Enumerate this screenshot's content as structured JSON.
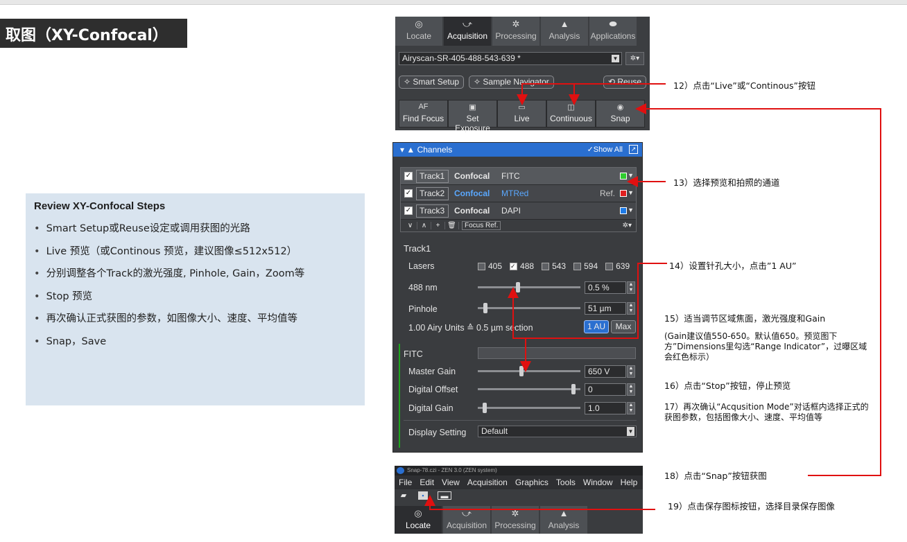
{
  "page_title": "取图（XY-Confocal）",
  "review": {
    "heading": "Review XY-Confocal Steps",
    "items": [
      "Smart Setup或Reuse设定或调用获图的光路",
      "Live 预览（或Continous 预览，建议图像≤512x512）",
      "分别调整各个Track的激光强度, Pinhole, Gain，Zoom等",
      "Stop 预览",
      "再次确认正式获图的参数，如图像大小、速度、平均值等",
      "Snap，Save"
    ]
  },
  "zen_top": {
    "tabs": [
      {
        "label": "Locate",
        "icon": "locate-icon"
      },
      {
        "label": "Acquisition",
        "icon": "acquisition-icon"
      },
      {
        "label": "Processing",
        "icon": "processing-icon"
      },
      {
        "label": "Analysis",
        "icon": "analysis-icon"
      },
      {
        "label": "Applications",
        "icon": "applications-icon"
      }
    ],
    "active_tab": "Acquisition",
    "config_value": "Airyscan-SR-405-488-543-639 *",
    "smart_setup": "Smart Setup",
    "sample_navigator": "Sample Navigator",
    "reuse": "Reuse",
    "buttons": [
      {
        "label": "Find Focus",
        "icon_text": "AF"
      },
      {
        "label": "Set Exposure",
        "icon_text": "▣"
      },
      {
        "label": "Live",
        "icon_text": "▭"
      },
      {
        "label": "Continuous",
        "icon_text": "◫"
      },
      {
        "label": "Snap",
        "icon_text": "◉"
      }
    ]
  },
  "channels": {
    "header": "Channels",
    "show_all": "Show All",
    "tracks": [
      {
        "name": "Track1",
        "mode": "Confocal",
        "dye": "FITC",
        "ref": "",
        "color": "#2ecc2e",
        "mode_color": "#ffffff",
        "dye_color": "#ffffff"
      },
      {
        "name": "Track2",
        "mode": "Confocal",
        "dye": "MTRed",
        "ref": "Ref.",
        "color": "#e02020",
        "mode_color": "#5aa8ff",
        "dye_color": "#5aa8ff"
      },
      {
        "name": "Track3",
        "mode": "Confocal",
        "dye": "DAPI",
        "ref": "",
        "color": "#1e7be8",
        "mode_color": "#ffffff",
        "dye_color": "#ffffff"
      }
    ],
    "focus_ref": "Focus Ref.",
    "track_label": "Track1",
    "lasers_label": "Lasers",
    "lasers": [
      {
        "wl": "405",
        "checked": false
      },
      {
        "wl": "488",
        "checked": true
      },
      {
        "wl": "543",
        "checked": false
      },
      {
        "wl": "594",
        "checked": false
      },
      {
        "wl": "639",
        "checked": false
      }
    ],
    "laser_nm_label": "488 nm",
    "laser_value": "0.5 %",
    "pinhole_label": "Pinhole",
    "pinhole_value": "51 µm",
    "airy_text": "1.00 Airy Units ≙ 0.5 µm section",
    "au_button": "1 AU",
    "max_button": "Max",
    "fitc_label": "FITC",
    "master_gain_label": "Master Gain",
    "master_gain_value": "650 V",
    "digital_offset_label": "Digital Offset",
    "digital_offset_value": "0",
    "digital_gain_label": "Digital Gain",
    "digital_gain_value": "1.0",
    "display_setting_label": "Display Setting",
    "display_setting_value": "Default"
  },
  "zen_bottom": {
    "window_title": "Snap-78.czi - ZEN 3.0 (ZEN system)",
    "menu": [
      "File",
      "Edit",
      "View",
      "Acquisition",
      "Graphics",
      "Tools",
      "Window",
      "Help"
    ],
    "tabs": [
      {
        "label": "Locate",
        "icon": "locate-icon"
      },
      {
        "label": "Acquisition",
        "icon": "acquisition-icon"
      },
      {
        "label": "Processing",
        "icon": "processing-icon"
      },
      {
        "label": "Analysis",
        "icon": "analysis-icon"
      }
    ],
    "active_tab": "Locate"
  },
  "notes": {
    "n12": "12）点击“Live”或“Continous”按钮",
    "n13": "13）选择预览和拍照的通道",
    "n14": "14）设置针孔大小，点击”1 AU”",
    "n15a": "15）适当调节区域焦面，激光强度和Gain",
    "n15b": "(Gain建议值550-650。默认值650。预览图下方”Dimensions里勾选“Range Indicator”，过曝区域会红色标示）",
    "n16": "16）点击“Stop”按钮，停止预览",
    "n17": "17）再次确认“Acqusition Mode”对话框内选择正式的获图参数，包括图像大小、速度、平均值等",
    "n18": "18）点击“Snap”按钮获图",
    "n19": "19）点击保存图标按钮，选择目录保存图像"
  },
  "colors": {
    "arrow": "#e01010",
    "panel_bg": "#3a3c3f",
    "accent_blue": "#2a6fd0",
    "review_bg": "#d9e4ef",
    "title_bg": "#2e2e2e"
  }
}
